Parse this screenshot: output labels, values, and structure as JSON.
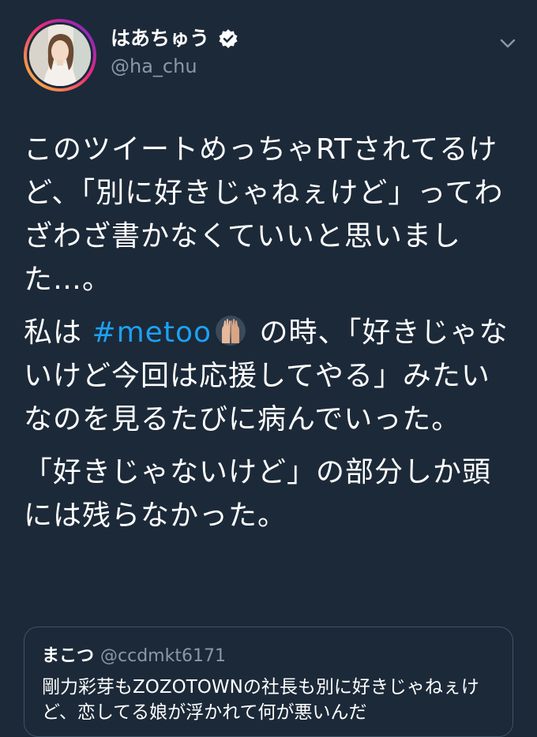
{
  "author": {
    "display_name": "はあちゅう",
    "handle": "@ha_chu",
    "verified": true
  },
  "tweet": {
    "para1": "このツイートめっちゃRTされてるけど、「別に好きじゃねぇけど」ってわざわざ書かなくていいと思いました…。",
    "para2_before": "私は ",
    "para2_hashtag": "#metoo",
    "para2_after": " の時、「好きじゃないけど今回は応援してやる」みたいなのを見るたびに病んでいった。",
    "para3": "「好きじゃないけど」の部分しか頭には残らなかった。"
  },
  "quoted_tweet": {
    "display_name": "まこつ",
    "handle": "@ccdmkt6171",
    "text": "剛力彩芽もZOZOTOWNの社長も別に好きじゃねぇけど、恋してる娘が浮かれて何が悪いんだ"
  },
  "colors": {
    "background": "#1c2938",
    "link": "#1da1f2",
    "secondary_text": "#8899a6",
    "border": "#3d5466"
  },
  "icons": {
    "verified": "verified-badge-icon",
    "menu": "chevron-down-icon",
    "emoji": "raised-hands-emoji-icon"
  }
}
